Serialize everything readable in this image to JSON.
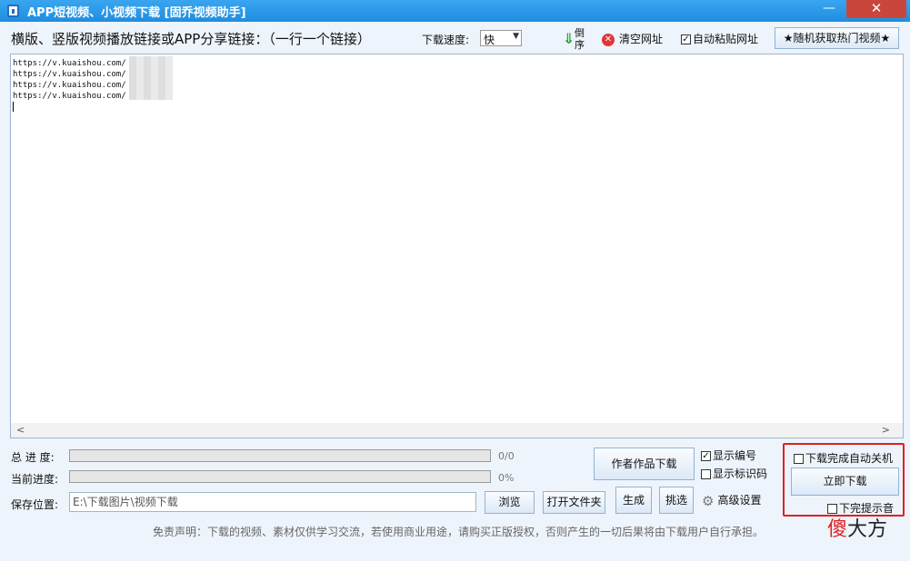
{
  "window": {
    "title": "APP短视频、小视频下载 [固乔视频助手]",
    "minimize_glyph": "—",
    "close_glyph": "✕"
  },
  "toolbar": {
    "label": "横版、竖版视频播放链接或APP分享链接：（一行一个链接）",
    "speed_label": "下载速度:",
    "speed_value": "快",
    "reverse_label": "倒序",
    "clear_label": "清空网址",
    "autopaste_label": "自动粘贴网址",
    "autopaste_checked": true,
    "hot_button_label": "★随机获取热门视频★"
  },
  "links": [
    "https://v.kuaishou.com/",
    "https://v.kuaishou.com/",
    "https://v.kuaishou.com/",
    "https://v.kuaishou.com/"
  ],
  "progress": {
    "total_label": "总 进 度:",
    "total_value": "0/0",
    "total_fraction": 0,
    "current_label": "当前进度:",
    "current_value": "0%",
    "current_fraction": 0
  },
  "save": {
    "label": "保存位置:",
    "path": "E:\\下载图片\\视频下载",
    "browse_label": "浏览",
    "open_folder_label": "打开文件夹"
  },
  "actions": {
    "author_download_label": "作者作品下载",
    "generate_label": "生成",
    "pick_label": "挑选",
    "show_number_label": "显示编号",
    "show_number_checked": true,
    "show_code_label": "显示标识码",
    "show_code_checked": false,
    "advanced_label": "高级设置"
  },
  "download_panel": {
    "shutdown_label": "下载完成自动关机",
    "shutdown_checked": false,
    "download_now_label": "立即下载",
    "sound_label": "下完提示音",
    "sound_checked": false
  },
  "disclaimer": "免责声明：下载的视频、素材仅供学习交流，若使用商业用途，请购买正版授权，否则产生的一切后果将由下载用户自行承担。",
  "watermark": {
    "first": "傻",
    "rest": "大方"
  },
  "colors": {
    "titlebar": "#1e8ee0",
    "close": "#c9463d",
    "highlight_box": "#e02020",
    "progress_fill": "#2db94d"
  }
}
